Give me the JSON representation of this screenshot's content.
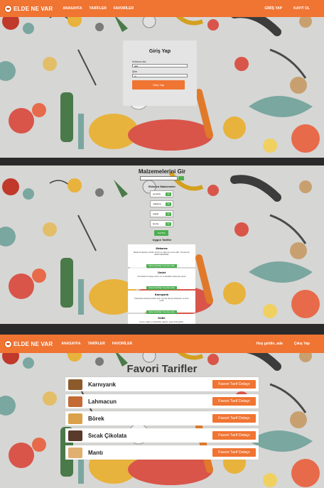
{
  "colors": {
    "brand": "#f07432",
    "accent_green": "#4caf50"
  },
  "brand": {
    "name": "ELDE NE VAR"
  },
  "frame1": {
    "nav": {
      "items": [
        "ANASAYFA",
        "TARİFLER",
        "FAVORİLER"
      ],
      "right": [
        "GİRİŞ YAP",
        "KAYIT OL"
      ]
    },
    "login": {
      "title": "Giriş Yap",
      "username_label": "Kullanıcı Adı",
      "username_value": "ada",
      "password_label": "Şifre",
      "password_value": "•••",
      "button": "Giriş Yap"
    }
  },
  "frame2": {
    "title": "Malzemelerini Gir",
    "list_title": "Eklenen Malzemeler",
    "ingredients": [
      {
        "name": "yumurta",
        "remove": "Sil"
      },
      {
        "name": "makarna",
        "remove": "Sil"
      },
      {
        "name": "yoğurt",
        "remove": "Sil"
      },
      {
        "name": "kıyma",
        "remove": "Sil"
      }
    ],
    "find_button": "Tarif Bul",
    "suitable_title": "Uygun Tarifler",
    "recipes": [
      {
        "name": "Mekarna",
        "desc": "Makarna haşlanıp süzülür, kıyma ve yoğurt ile servis edilir. Yanında sos olarak kullanılabilir.",
        "button": "Daha Fazla Bilgi / Favorilere Ekle"
      },
      {
        "name": "Omlet",
        "desc": "Yumurtalar bir kaseye kırılır, tuz ve karabiber eklenerek çırpılır.",
        "button": "Daha Fazla Bilgi / Favorilere Ekle"
      },
      {
        "name": "Karnıyarık",
        "desc": "Patlıcanlar kızartılıp ortaları açılır, kıymalı harç ile doldurulur ve fırına verilir.",
        "button": "Daha Fazla Bilgi / Favorilere Ekle"
      },
      {
        "name": "Köfte",
        "desc": "Kıyma, soğan ve baharatlar yoğrulur, şekil verilip pişirilir.",
        "button": ""
      }
    ]
  },
  "frame3": {
    "nav": {
      "items": [
        "ANASAYFA",
        "TARİFLER",
        "FAVORİLER"
      ],
      "greeting": "Hoş geldin, ada",
      "logout": "Çıkış Yap"
    },
    "title": "Favori Tarifler",
    "favorites": [
      {
        "name": "Karnıyarık",
        "button": "Favori Tarif Detayı",
        "thumb_color": "#8d5a2b"
      },
      {
        "name": "Lahmacun",
        "button": "Favori Tarif Detayı",
        "thumb_color": "#c46a35"
      },
      {
        "name": "Börek",
        "button": "Favori Tarif Detayı",
        "thumb_color": "#d9a24a"
      },
      {
        "name": "Sıcak Çikolata",
        "button": "Favori Tarif Detayı",
        "thumb_color": "#5a3a2a"
      },
      {
        "name": "Mantı",
        "button": "Favori Tarif Detayı",
        "thumb_color": "#e0b070"
      }
    ]
  }
}
